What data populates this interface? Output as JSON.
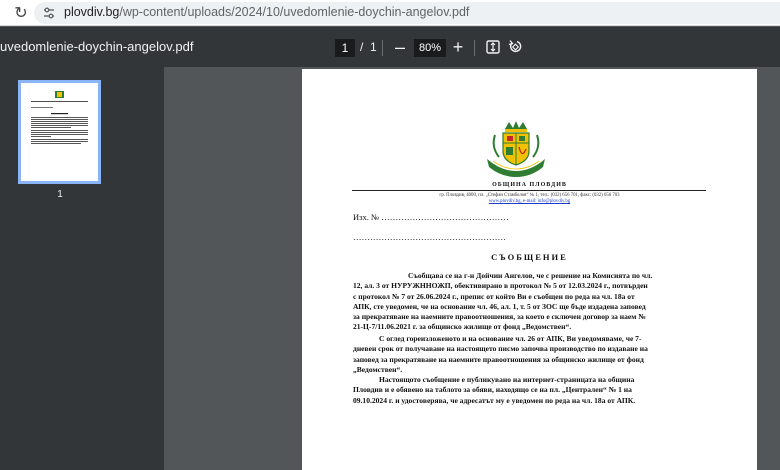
{
  "browser": {
    "url_host": "plovdiv.bg",
    "url_path": "/wp-content/uploads/2024/10/uvedomlenie-doychin-angelov.pdf"
  },
  "toolbar": {
    "file_title": "uvedomlenie-doychin-angelov.pdf",
    "current_page": "1",
    "page_separator": "/",
    "total_pages": "1",
    "zoom_out": "–",
    "zoom_level": "80%",
    "zoom_in": "+"
  },
  "sidebar": {
    "thumbnail_label": "1"
  },
  "document": {
    "municipality_name": "ОБЩИНА ПЛОВДИВ",
    "municipality_address": "гр. Пловдив, 4000, пл. „Стефан Стамболов“ № 1, тел.: (032) 656 701, факс: (032) 656 703",
    "municipality_web": "www.plovdiv.bg, e-mail: info@plovdiv.bg",
    "ref_number": "Изх. № ………………………………………",
    "ref_date": "………………………………………………",
    "heading": "СЪОБЩЕНИЕ",
    "paragraph1_lines": [
      "Съобщава се на г-н  Дойчин  Ангелов, че с решение на Комисията по чл.",
      "12, ал. 3 от НУРУЖННОЖП, обективирано в протокол № 5 от 12.03.2024 г., потвърден",
      "с протокол № 7 от 26.06.2024 г.,  препис от който Ви е съобщен по реда на чл. 18а от",
      "АПК, сте уведомен, че на основание чл. 46, ал. 1, т. 5 от ЗОС ще бъде издадена заповед",
      "за прекратяване на наемните правоотношения, за което е сключен договор за наем №",
      "21-Ц-7/11.06.2021 г. за общинско жилище от фонд „Ведомствен“."
    ],
    "paragraph2_lines": [
      "С оглед гореизложеното и на основание чл. 26 от АПК, Ви уведомяваме, че 7-",
      "дневен срок от получаване на настоящето писмо започва производство по издаване на",
      "заповед за прекратяване на наемните правоотношения за общинско жилище от фонд",
      "„Ведомствен“."
    ],
    "paragraph3_lines": [
      "Настоящото съобщение е публикувано на интернет-страницата на община",
      "Пловдив и е обявено на таблото за обяви, находящо се на пл. „Централен“ № 1 на",
      "09.10.2024 г. и удостоверява, че адресатът му е уведомен по реда на чл. 18а от АПК."
    ]
  },
  "colors": {
    "toolbar_bg": "#323639",
    "viewer_bg": "#525659",
    "thumbnail_border": "#8ab4f8",
    "link_blue": "#1a3cc8"
  },
  "icons": [
    "reload-icon",
    "site-info-icon",
    "fit-to-page-icon",
    "rotate-icon",
    "municipal-crest-icon"
  ]
}
